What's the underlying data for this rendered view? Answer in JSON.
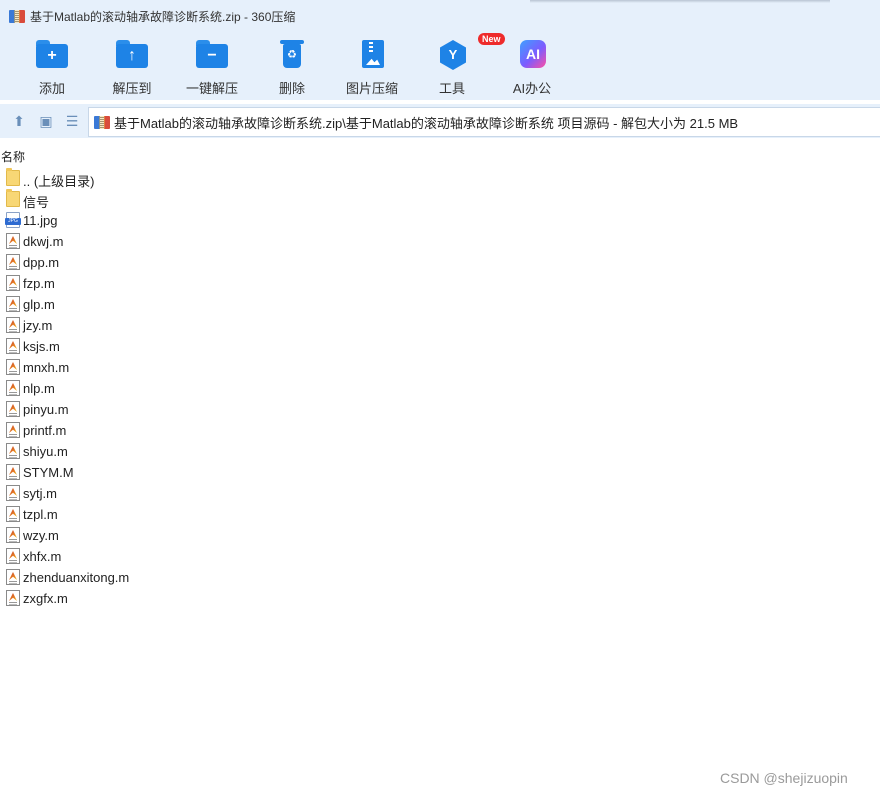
{
  "window": {
    "title": "基于Matlab的滚动轴承故障诊断系统.zip - 360压缩",
    "icon": "archive-icon"
  },
  "toolbar": {
    "buttons": [
      {
        "label": "添加",
        "icon": "add-folder-icon"
      },
      {
        "label": "解压到",
        "icon": "extract-to-icon"
      },
      {
        "label": "一键解压",
        "icon": "one-click-extract-icon"
      },
      {
        "label": "删除",
        "icon": "trash-icon"
      },
      {
        "label": "图片压缩",
        "icon": "image-compress-icon"
      },
      {
        "label": "工具",
        "icon": "tools-icon",
        "badge": "New"
      },
      {
        "label": "AI办公",
        "icon": "ai-office-icon",
        "glyph": "AI"
      }
    ]
  },
  "navigation": {
    "up_icon": "up-arrow-icon",
    "view_icon": "thumbnail-view-icon",
    "list_icon": "list-view-icon",
    "address": "基于Matlab的滚动轴承故障诊断系统.zip\\基于Matlab的滚动轴承故障诊断系统 项目源码 - 解包大小为 21.5 MB"
  },
  "file_list": {
    "column_header": "名称",
    "items": [
      {
        "name": ".. (上级目录)",
        "type": "folder"
      },
      {
        "name": "信号",
        "type": "folder"
      },
      {
        "name": "11.jpg",
        "type": "jpg"
      },
      {
        "name": "dkwj.m",
        "type": "m"
      },
      {
        "name": "dpp.m",
        "type": "m"
      },
      {
        "name": "fzp.m",
        "type": "m"
      },
      {
        "name": "glp.m",
        "type": "m"
      },
      {
        "name": "jzy.m",
        "type": "m"
      },
      {
        "name": "ksjs.m",
        "type": "m"
      },
      {
        "name": "mnxh.m",
        "type": "m"
      },
      {
        "name": "nlp.m",
        "type": "m"
      },
      {
        "name": "pinyu.m",
        "type": "m"
      },
      {
        "name": "printf.m",
        "type": "m"
      },
      {
        "name": "shiyu.m",
        "type": "m"
      },
      {
        "name": "STYM.M",
        "type": "m"
      },
      {
        "name": "sytj.m",
        "type": "m"
      },
      {
        "name": "tzpl.m",
        "type": "m"
      },
      {
        "name": "wzy.m",
        "type": "m"
      },
      {
        "name": "xhfx.m",
        "type": "m"
      },
      {
        "name": "zhenduanxitong.m",
        "type": "m"
      },
      {
        "name": "zxgfx.m",
        "type": "m"
      }
    ]
  },
  "watermark": "CSDN @shejizuopin",
  "colors": {
    "toolbar_bg": "#e6f0fb",
    "accent_blue": "#1e83e6",
    "badge_red": "#ee2b2b"
  }
}
